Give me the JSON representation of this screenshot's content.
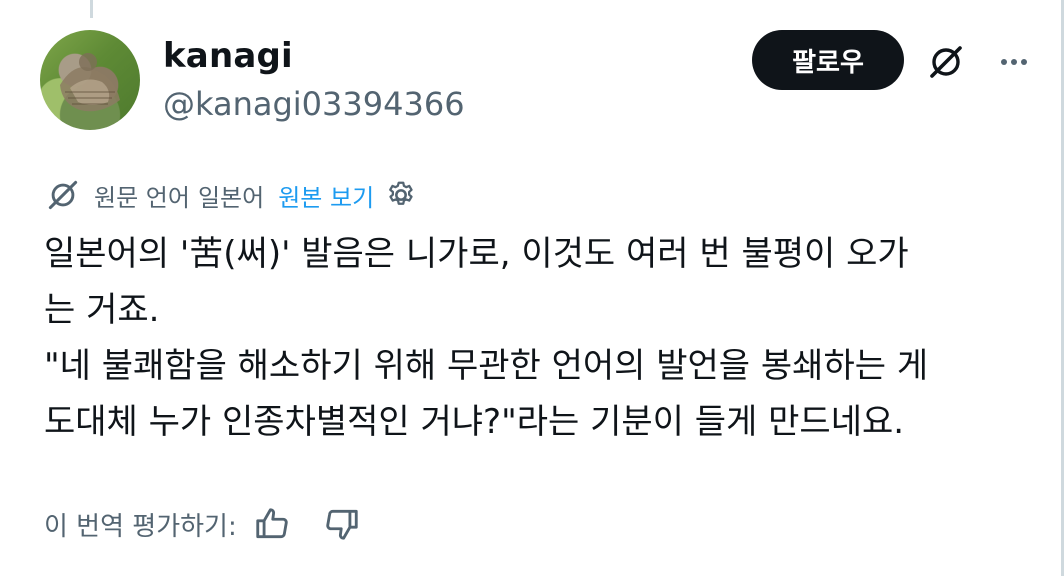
{
  "author": {
    "name": "kanagi",
    "handle": "@kanagi03394366"
  },
  "actions": {
    "follow_label": "팔로우",
    "grok_icon": "grok-icon",
    "more_icon": "more-icon"
  },
  "translation": {
    "original_label": "원문 언어",
    "language": "일본어",
    "show_original": "원본 보기",
    "settings_icon": "gear-icon"
  },
  "tweet": {
    "lines": [
      "일본어의 '苦(써)' 발음은 니가로, 이것도 여러 번 불평이 오가",
      "는 거죠.",
      "\"네 불쾌함을 해소하기 위해 무관한 언어의 발언을 봉쇄하는 게",
      "도대체 누가 인종차별적인 거냐?\"라는 기분이 들게 만드네요."
    ]
  },
  "rating": {
    "label": "이 번역 평가하기:",
    "thumbs_up_icon": "thumbs-up-icon",
    "thumbs_down_icon": "thumbs-down-icon"
  },
  "colors": {
    "text": "#0f1419",
    "secondary": "#536471",
    "link": "#1d9bf0",
    "button_bg": "#0f1419"
  }
}
